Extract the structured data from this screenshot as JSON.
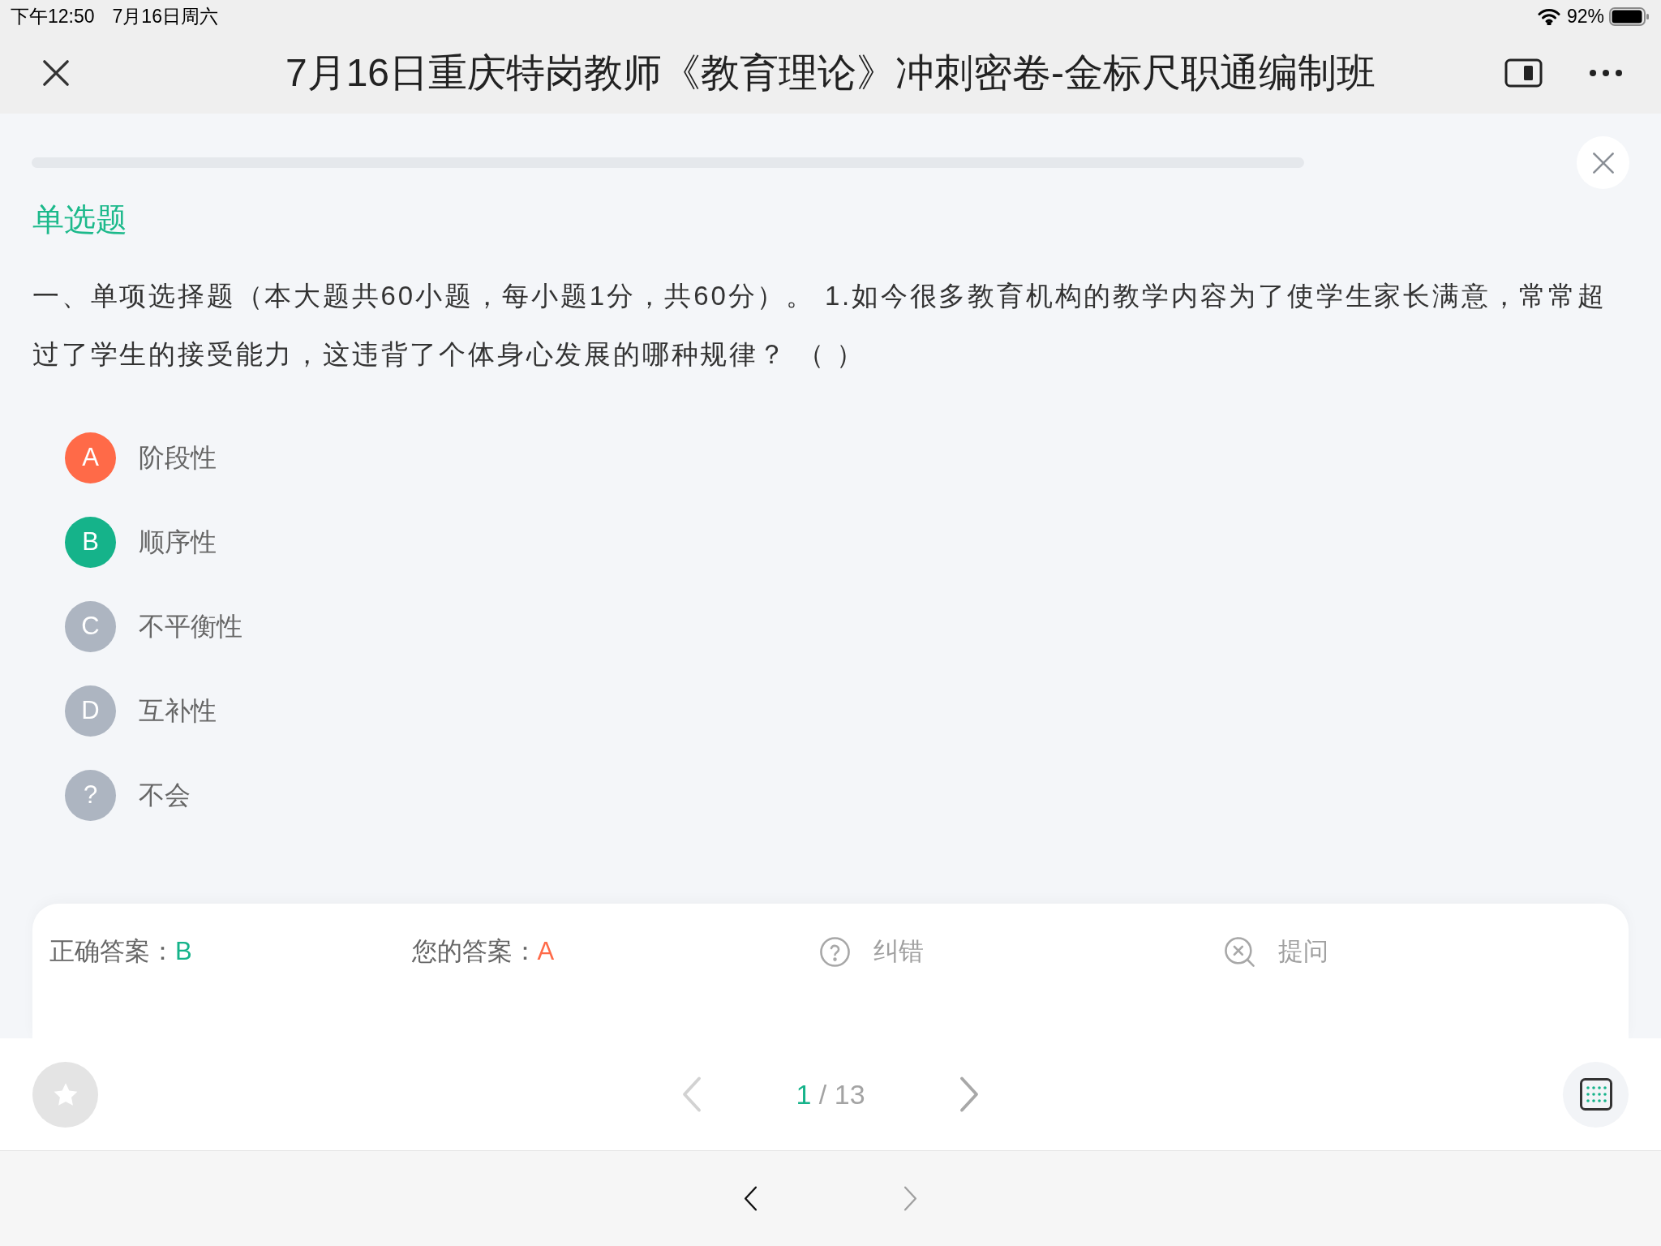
{
  "status_bar": {
    "time": "下午12:50",
    "date": "7月16日周六",
    "battery": "92%"
  },
  "nav_bar": {
    "title": "7月16日重庆特岗教师《教育理论》冲刺密卷-金标尺职通编制班"
  },
  "progress": {
    "level": 0
  },
  "question": {
    "type_label": "单选题",
    "text": "一、单项选择题（本大题共60小题，每小题1分，共60分）。 1.如今很多教育机构的教学内容为了使学生家长满意，常常超过了学生的接受能力，这违背了个体身心发展的哪种规律？ （ ）",
    "options": [
      {
        "letter": "A",
        "label": "阶段性",
        "selected": true,
        "correct": false
      },
      {
        "letter": "B",
        "label": "顺序性",
        "selected": false,
        "correct": true
      },
      {
        "letter": "C",
        "label": "不平衡性",
        "selected": false,
        "correct": false
      },
      {
        "letter": "D",
        "label": "互补性",
        "selected": false,
        "correct": false
      },
      {
        "letter": "?",
        "label": "不会",
        "selected": false,
        "correct": false
      }
    ]
  },
  "answer_card": {
    "correct_answer": {
      "label": "正确答案：",
      "value": "B"
    },
    "your_answer": {
      "label": "您的答案：",
      "value": "A",
      "correct": false
    },
    "actions": [
      {
        "kind": "report",
        "label": "纠错"
      },
      {
        "kind": "ask",
        "label": "提问"
      }
    ]
  },
  "toolbar": {
    "favorited": false,
    "prev_disabled": true,
    "next_disabled": false,
    "current": "1",
    "separator": "/",
    "total": "13"
  },
  "browser_nav": {
    "back_disabled": false,
    "forward_disabled": true
  }
}
